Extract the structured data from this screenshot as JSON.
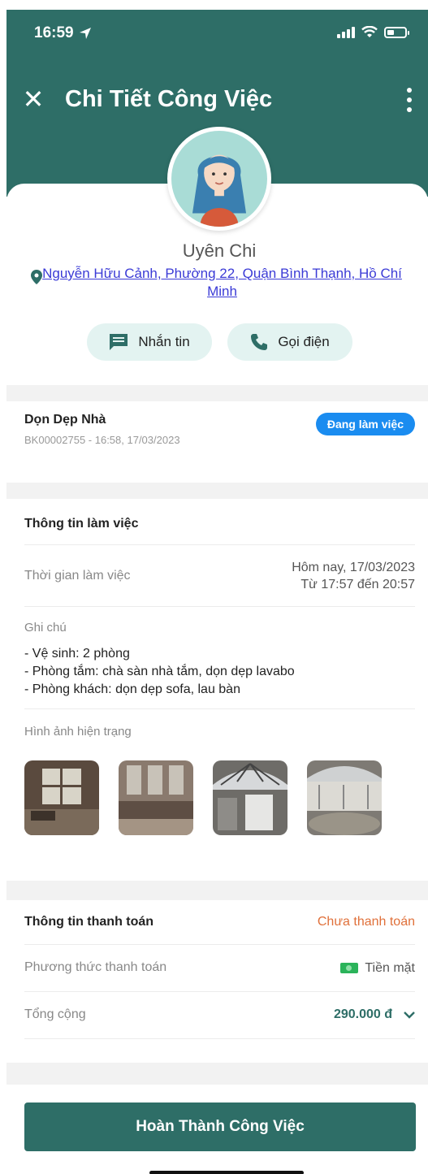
{
  "status_bar": {
    "time": "16:59"
  },
  "header": {
    "title": "Chi Tiết Công Việc"
  },
  "profile": {
    "name": "Uyên Chi",
    "address": "Nguyễn Hữu Cảnh, Phường 22, Quận Bình Thạnh, Hồ Chí Minh",
    "message_label": "Nhắn tin",
    "call_label": "Gọi điện"
  },
  "job": {
    "title": "Dọn Dẹp Nhà",
    "meta": "BK00002755 - 16:58, 17/03/2023",
    "status": "Đang làm việc"
  },
  "work_info": {
    "title": "Thông tin làm việc",
    "time_label": "Thời gian làm việc",
    "time_value_line1": "Hôm nay, 17/03/2023",
    "time_value_line2": "Từ 17:57 đến 20:57",
    "notes_label": "Ghi chú",
    "notes": [
      "- Vệ sinh: 2 phòng",
      "- Phòng tắm: chà sàn nhà tắm, dọn dẹp lavabo",
      "- Phòng khách: dọn dẹp sofa, lau bàn"
    ],
    "photos_label": "Hình ảnh hiện trạng"
  },
  "payment": {
    "title": "Thông tin thanh toán",
    "status": "Chưa thanh toán",
    "method_label": "Phương thức thanh toán",
    "method_value": "Tiền mặt",
    "total_label": "Tổng cộng",
    "total_value": "290.000 đ"
  },
  "footer": {
    "complete_label": "Hoàn Thành Công Việc"
  },
  "colors": {
    "primary": "#2e6e67",
    "badge": "#1a8cf0",
    "unpaid": "#e0703a",
    "link": "#3b3bd6"
  }
}
